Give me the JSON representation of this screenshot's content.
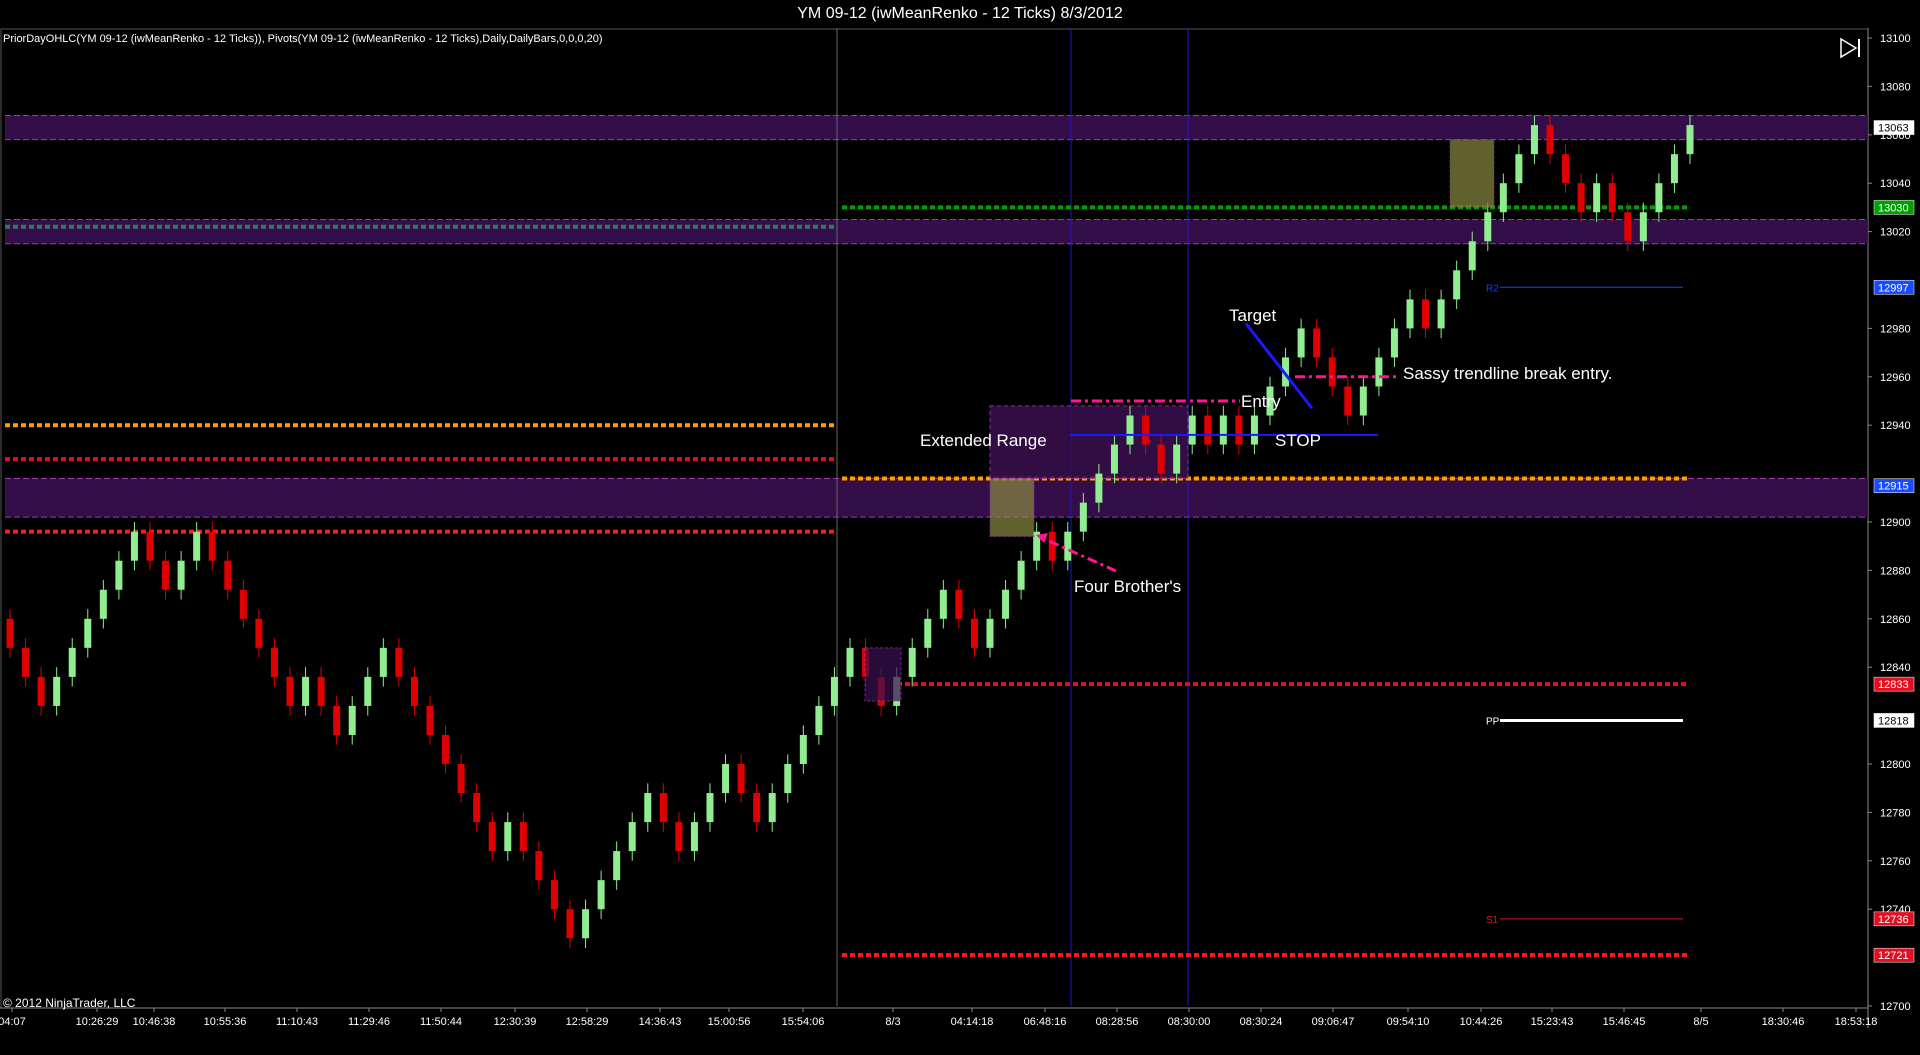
{
  "window": {
    "title": "YM 09-12 (iwMeanRenko - 12 Ticks)  8/3/2012",
    "indicators": "PriorDayOHLC(YM 09-12 (iwMeanRenko - 12 Ticks)), Pivots(YM 09-12 (iwMeanRenko - 12 Ticks),Daily,DailyBars,0,0,0,20)",
    "copyright": "© 2012 NinjaTrader, LLC",
    "nav_icon": "skip-to-end-icon"
  },
  "annotations": {
    "target": "Target",
    "entry": "Entry",
    "stop": "STOP",
    "extended_range": "Extended Range",
    "four_brothers": "Four Brother's",
    "sassy": "Sassy trendline break entry."
  },
  "chart_data": {
    "type": "renko",
    "ylim": [
      12700,
      13100
    ],
    "y_ticks": [
      13100,
      13080,
      13060,
      13040,
      13020,
      12980,
      12960,
      12940,
      12900,
      12880,
      12860,
      12840,
      12800,
      12780,
      12760,
      12740,
      12700
    ],
    "x_ticks": [
      "04:07",
      "10:26:29",
      "10:46:38",
      "10:55:36",
      "11:10:43",
      "11:29:46",
      "11:50:44",
      "12:30:39",
      "12:58:29",
      "14:36:43",
      "15:00:56",
      "15:54:06",
      "8/3",
      "04:14:18",
      "06:48:16",
      "08:28:56",
      "08:30:00",
      "08:30:24",
      "09:06:47",
      "09:54:10",
      "10:44:26",
      "15:23:43",
      "15:46:45",
      "8/5",
      "18:30:46",
      "18:53:18"
    ],
    "price_markers": [
      {
        "label": "13063",
        "value": 13063,
        "color": "#ffffff"
      },
      {
        "label": "13030",
        "value": 13030,
        "color": "#00a000"
      },
      {
        "label": "12997",
        "value": 12997,
        "color": "#1a4cff"
      },
      {
        "label": "12915",
        "value": 12915,
        "color": "#1a4cff"
      },
      {
        "label": "12833",
        "value": 12833,
        "color": "#e01020"
      },
      {
        "label": "12818",
        "value": 12818,
        "color": "#ffffff"
      },
      {
        "label": "12736",
        "value": 12736,
        "color": "#e01020"
      },
      {
        "label": "12721",
        "value": 12721,
        "color": "#e01020"
      }
    ],
    "pivots": [
      {
        "name": "R2",
        "value": 12997,
        "color": "#1a3cff"
      },
      {
        "name": "PP",
        "value": 12818,
        "color": "#ffffff"
      },
      {
        "name": "S1",
        "value": 12736,
        "color": "#e01020"
      }
    ],
    "colors": {
      "up": "#90ee90",
      "down": "#e00000",
      "neutral": "#c0c0c0",
      "zone": "#3a1050",
      "zone_border": "#9b3ab0",
      "prior_high": "#ffa000",
      "prior_close": "#e01020",
      "prior_low": "#ff1a1a",
      "prior_green": "#00a000",
      "annotation_pink": "#ff1493",
      "stop_line": "#1a1aff",
      "session_line": "#1a1acc"
    },
    "closes": [
      12848,
      12836,
      12824,
      12836,
      12848,
      12860,
      12872,
      12884,
      12896,
      12884,
      12872,
      12884,
      12896,
      12884,
      12872,
      12860,
      12848,
      12836,
      12824,
      12836,
      12824,
      12812,
      12824,
      12836,
      12848,
      12836,
      12824,
      12812,
      12800,
      12788,
      12776,
      12764,
      12776,
      12764,
      12752,
      12740,
      12728,
      12740,
      12752,
      12764,
      12776,
      12788,
      12776,
      12764,
      12776,
      12788,
      12800,
      12788,
      12776,
      12788,
      12800,
      12812,
      12824,
      12836,
      12848,
      12836,
      12824,
      12836,
      12848,
      12860,
      12872,
      12860,
      12848,
      12860,
      12872,
      12884,
      12896,
      12884,
      12896,
      12908,
      12920,
      12932,
      12944,
      12932,
      12920,
      12932,
      12944,
      12932,
      12944,
      12932,
      12944,
      12956,
      12968,
      12980,
      12968,
      12956,
      12944,
      12956,
      12968,
      12980,
      12992,
      12980,
      12992,
      13004,
      13016,
      13028,
      13040,
      13052,
      13064,
      13052,
      13040,
      13028,
      13040,
      13028,
      13016,
      13028,
      13040,
      13052,
      13064
    ]
  }
}
